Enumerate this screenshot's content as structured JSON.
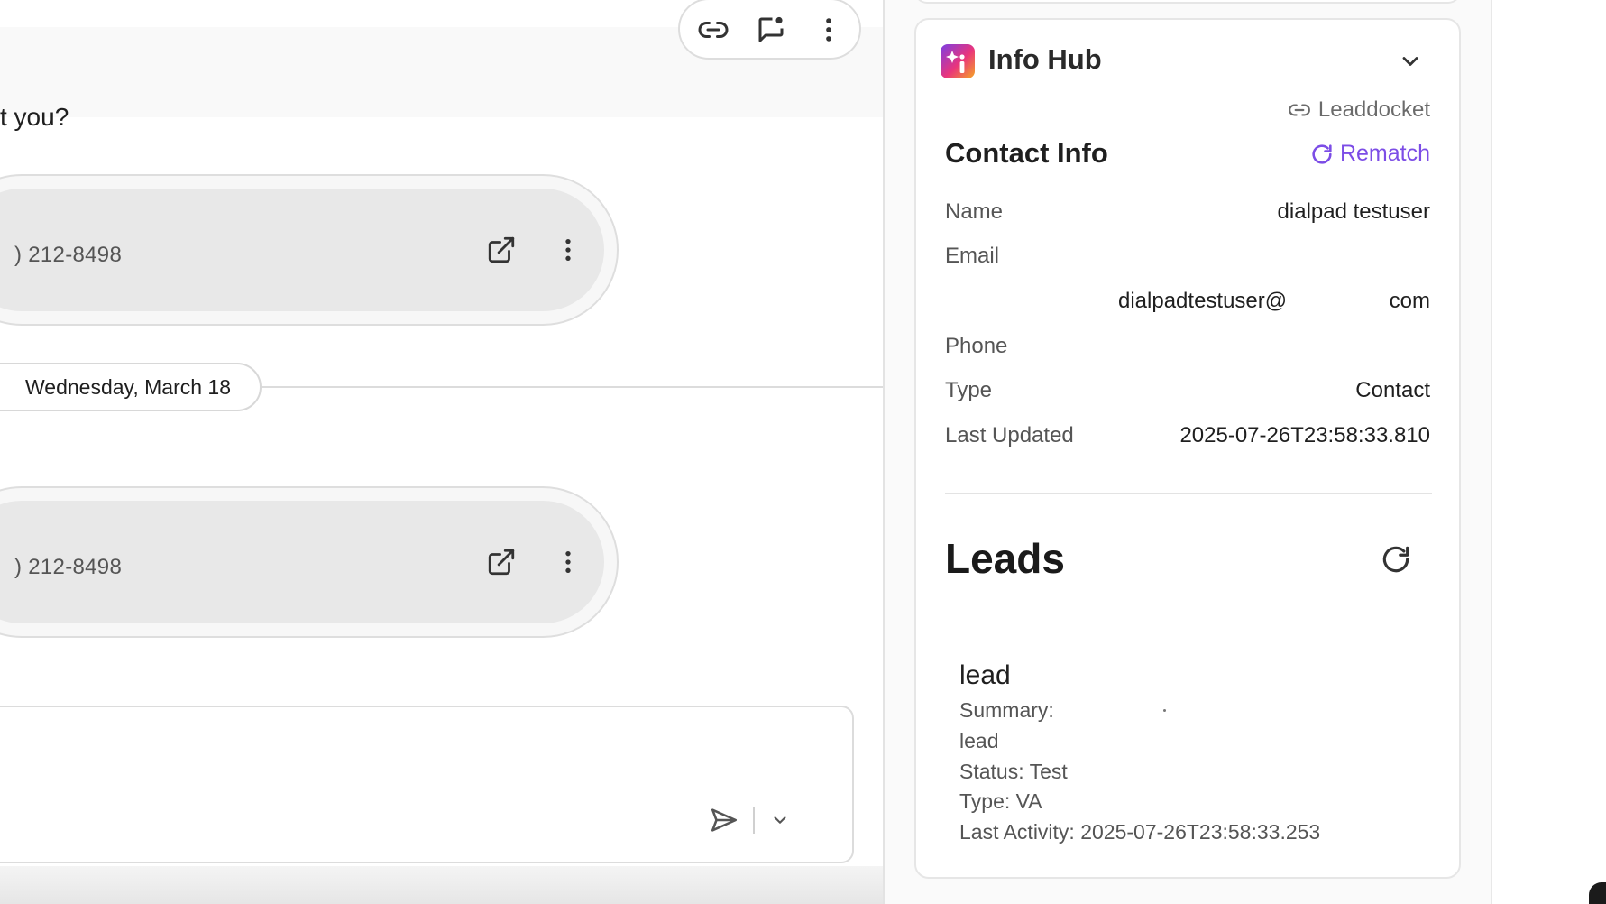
{
  "conversation": {
    "message_text": "t you?",
    "toolbar": {
      "copy_link_icon": "link-icon",
      "annotate_icon": "comment-flag-icon",
      "more_icon": "more-vertical-icon"
    },
    "call_cards": [
      {
        "number": ") 212-8498",
        "open_icon": "external-link-icon",
        "more_icon": "more-vertical-icon"
      },
      {
        "number": ") 212-8498",
        "open_icon": "external-link-icon",
        "more_icon": "more-vertical-icon"
      }
    ],
    "date_separator": "Wednesday, March 18",
    "composer": {
      "send_icon": "send-icon",
      "send_options_icon": "chevron-down-icon"
    }
  },
  "info_hub": {
    "title": "Info Hub",
    "logo_icon": "info-sparkle-logo",
    "collapse_icon": "chevron-down-icon",
    "source_link": "Leaddocket",
    "contact_info": {
      "title": "Contact Info",
      "rematch_label": "Rematch",
      "name_label": "Name",
      "name_value": "dialpad testuser",
      "email_label": "Email",
      "email_user": "dialpadtestuser@",
      "email_tld": "com",
      "phone_label": "Phone",
      "type_label": "Type",
      "type_value": "Contact",
      "updated_label": "Last Updated",
      "updated_value": "2025-07-26T23:58:33.810"
    },
    "leads": {
      "title": "Leads",
      "refresh_icon": "refresh-icon",
      "items": [
        {
          "name": "lead",
          "summary_label": "Summary:",
          "summary_value": "lead",
          "status": "Status: Test",
          "type": "Type: VA",
          "last_activity": "Last Activity: 2025-07-26T23:58:33.253"
        }
      ]
    }
  },
  "colors": {
    "accent": "#7c4de6",
    "text_primary": "#1f1f1f",
    "text_secondary": "#555555",
    "border": "#dcdcdc"
  }
}
